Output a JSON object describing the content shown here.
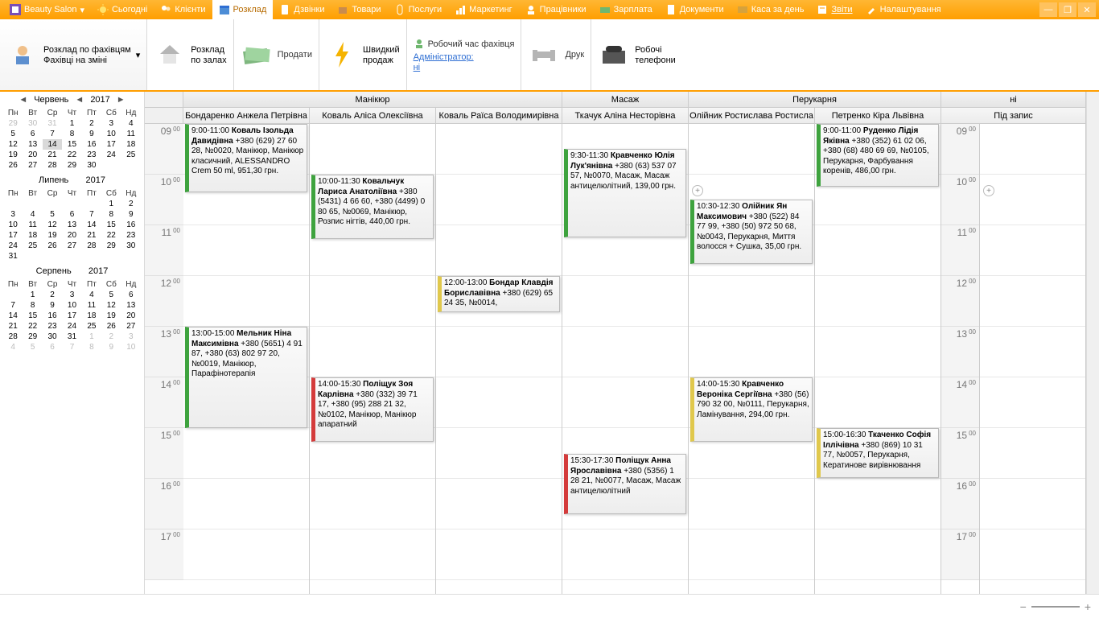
{
  "appTitle": "Beauty Salon",
  "menu": {
    "items": [
      {
        "icon": "sun",
        "label": "Сьогодні"
      },
      {
        "icon": "people",
        "label": "Клієнти"
      },
      {
        "icon": "calendar",
        "label": "Розклад",
        "active": true
      },
      {
        "icon": "phone",
        "label": "Дзвінки"
      },
      {
        "icon": "box",
        "label": "Товари"
      },
      {
        "icon": "clip",
        "label": "Послуги"
      },
      {
        "icon": "chart",
        "label": "Маркетинг"
      },
      {
        "icon": "worker",
        "label": "Працівники"
      },
      {
        "icon": "money",
        "label": "Зарплата"
      },
      {
        "icon": "doc",
        "label": "Документи"
      },
      {
        "icon": "cash",
        "label": "Каса за день"
      },
      {
        "icon": "report",
        "label": "Звіти"
      },
      {
        "icon": "wrench",
        "label": "Налаштування"
      }
    ]
  },
  "ribbon": {
    "scheduleBy": {
      "line1": "Розклад по фахівцям",
      "line2": "Фахівці на зміні"
    },
    "scheduleRooms": {
      "line1": "Розклад",
      "line2": "по залах"
    },
    "sell": "Продати",
    "quickSale": {
      "line1": "Швидкий",
      "line2": "продаж"
    },
    "workHours": {
      "title": "Робочий час фахівця",
      "admin": "Адміністратор:",
      "value": "ні"
    },
    "print": "Друк",
    "phones": {
      "line1": "Робочі",
      "line2": "телефони"
    }
  },
  "leftNav": {
    "month1": "Червень",
    "year1": "2017",
    "month2": "Липень",
    "year2": "2017",
    "month3": "Серпень",
    "year3": "2017",
    "dow": [
      "Пн",
      "Вт",
      "Ср",
      "Чт",
      "Пт",
      "Сб",
      "Нд"
    ]
  },
  "categories": [
    {
      "label": "Манікюр",
      "span": 3
    },
    {
      "label": "Масаж",
      "span": 1
    },
    {
      "label": "Перукарня",
      "span": 2
    },
    {
      "label": "ні",
      "span": 1
    }
  ],
  "employees": [
    "Бондаренко Анжела Петрівна",
    "Коваль Аліса Олексіївна",
    "Коваль Раїса Володимирівна",
    "Ткачук Аліна Несторівна",
    "Олійник Ростислава Ростисла",
    "Петренко Кіра Львівна",
    "Під запис"
  ],
  "hours": [
    "09",
    "10",
    "11",
    "12",
    "13",
    "14",
    "15",
    "16",
    "17"
  ],
  "events": {
    "c0e0": {
      "time": "9:00-11:00",
      "name": "Коваль Ізольда Давидівна",
      "rest": " +380 (629) 27 60 28, №0020, Манікюр, Манікюр класичний, ALESSANDRO Crem 50 ml, 951,30 грн."
    },
    "c0e1": {
      "time": "13:00-15:00",
      "name": "Мельник Ніна Максимівна",
      "rest": " +380 (5651) 4 91 87, +380 (63) 802 97 20, №0019, Манікюр, Парафінотерапія"
    },
    "c1e0": {
      "time": "10:00-11:30",
      "name": "Ковальчук Лариса Анатоліївна",
      "rest": " +380 (5431) 4 66 60, +380 (4499) 0 80 65, №0069, Манікюр, Розпис нігтів, 440,00 грн."
    },
    "c1e1": {
      "time": "14:00-15:30",
      "name": "Поліщук Зоя Карлівна",
      "rest": " +380 (332) 39 71 17, +380 (95) 288 21 32, №0102, Манікюр, Манікюр апаратний"
    },
    "c2e0": {
      "time": "12:00-13:00",
      "name": "Бондар Клавдія Бориславівна",
      "rest": " +380 (629) 65 24 35, №0014,"
    },
    "c3e0": {
      "time": "9:30-11:30",
      "name": "Кравченко Юлія Лук'янівна",
      "rest": " +380 (63) 537 07 57, №0070, Масаж, Масаж антицелюлітний, 139,00 грн."
    },
    "c3e1": {
      "time": "15:30-17:30",
      "name": "Поліщук Анна Ярославівна",
      "rest": " +380 (5356) 1 28 21, №0077, Масаж, Масаж антицелюлітний"
    },
    "c4e0": {
      "time": "10:30-12:30",
      "name": "Олійник Ян Максимович",
      "rest": " +380 (522) 84 77 99, +380 (50) 972 50 68, №0043, Перукарня, Миття волосся + Сушка, 35,00 грн."
    },
    "c4e1": {
      "time": "14:00-15:30",
      "name": "Кравченко Вероніка Сергіївна",
      "rest": " +380 (56) 790 32 00, №0111, Перукарня, Ламінування, 294,00 грн."
    },
    "c5e0": {
      "time": "9:00-11:00",
      "name": "Руденко Лідія Яківна",
      "rest": " +380 (352) 61 02 06, +380 (68) 480 69 69, №0105, Перукарня, Фарбування коренів, 486,00 грн."
    },
    "c5e1": {
      "time": "15:00-16:30",
      "name": "Ткаченко Софія Іллічівна",
      "rest": " +380 (869) 10 31 77, №0057, Перукарня, Кератинове вирівнювання"
    }
  }
}
